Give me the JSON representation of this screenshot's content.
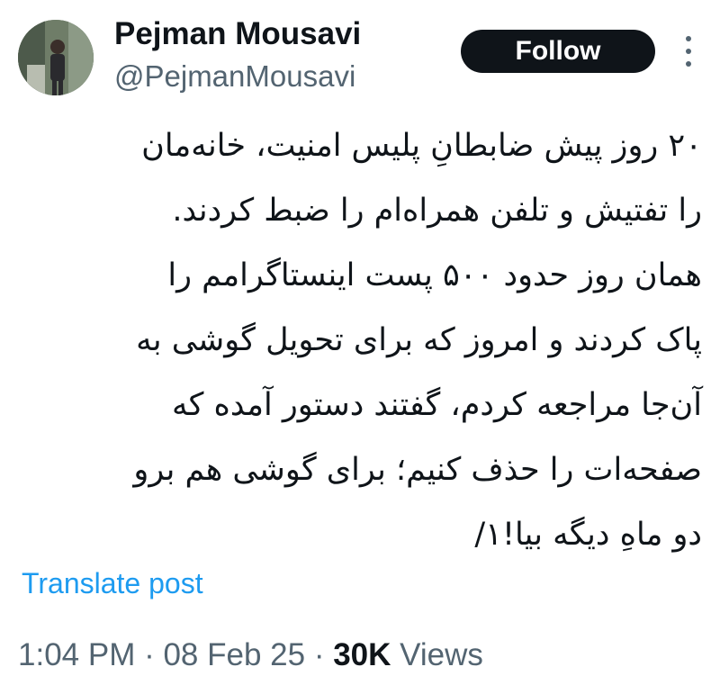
{
  "author": {
    "name": "Pejman Mousavi",
    "handle": "@PejmanMousavi"
  },
  "follow_button": {
    "label": "Follow"
  },
  "tweet": {
    "lines": [
      "۲۰ روز پیش ضابطانِ پلیس امنیت، خانه‌مان",
      "را تفتیش و تلفن همراه‌ام را ضبط کردند.",
      "همان روز حدود ۵۰۰ پست اینستاگرامم را",
      "پاک کردند و امروز که برای تحویل گوشی به",
      "آن‌جا مراجعه کردم، گفتند دستور آمده که",
      "صفحه‌ات را حذف کنیم؛ برای گوشی هم برو",
      "دو ماهِ دیگه بیا!۱/"
    ]
  },
  "translate": {
    "label": "Translate post"
  },
  "meta": {
    "time": "1:04 PM",
    "separator": " · ",
    "date": "08 Feb 25",
    "views_count": "30K",
    "views_label": " Views"
  },
  "colors": {
    "text": "#0f1419",
    "secondary": "#536471",
    "link": "#1d9bf0",
    "button_bg": "#0f1419"
  },
  "icons": {
    "more": "more-dots-icon",
    "avatar": "avatar-photo"
  }
}
